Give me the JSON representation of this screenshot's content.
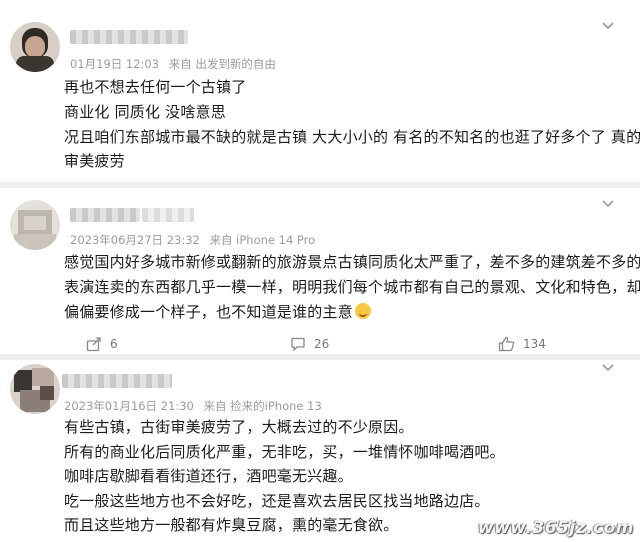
{
  "comments": [
    {
      "meta": {
        "date": "01月19日 12:03",
        "source": "来自 出发到新的自由"
      },
      "lines": [
        "再也不想去任何一个古镇了",
        "商业化 同质化 没啥意思",
        "况且咱们东部城市最不缺的就是古镇 大大小小的 有名的不知名的也逛了好多个了 真的",
        "审美疲劳"
      ]
    },
    {
      "meta": {
        "date": "2023年06月27日 23:32",
        "source": "来自 iPhone 14 Pro"
      },
      "lines": [
        "感觉国内好多城市新修或翻新的旅游景点古镇同质化太严重了，差不多的建筑差不多的",
        "表演连卖的东西都几乎一模一样，明明我们每个城市都有自己的景观、文化和特色，却",
        "偏偏要修成一个样子，也不知道是谁的主意"
      ],
      "actions": {
        "share": "6",
        "comments": "26",
        "likes": "134"
      }
    },
    {
      "meta": {
        "date": "2023年01月16日 21:30",
        "source": "来自 捡来的iPhone 13"
      },
      "lines": [
        "有些古镇，古街审美疲劳了，大概去过的不少原因。",
        "所有的商业化后同质化严重，无非吃，买，一堆情怀咖啡喝酒吧。",
        "咖啡店歇脚看看街道还行，酒吧毫无兴趣。",
        "吃一般这些地方也不会好吃，还是喜欢去居民区找当地路边店。",
        "而且这些地方一般都有炸臭豆腐，熏的毫无食欲。"
      ]
    }
  ],
  "watermark": "www.365jz.com",
  "icons": [
    "chevron-down-icon",
    "share-icon",
    "comment-icon",
    "like-icon",
    "laughing-emoji-icon"
  ]
}
